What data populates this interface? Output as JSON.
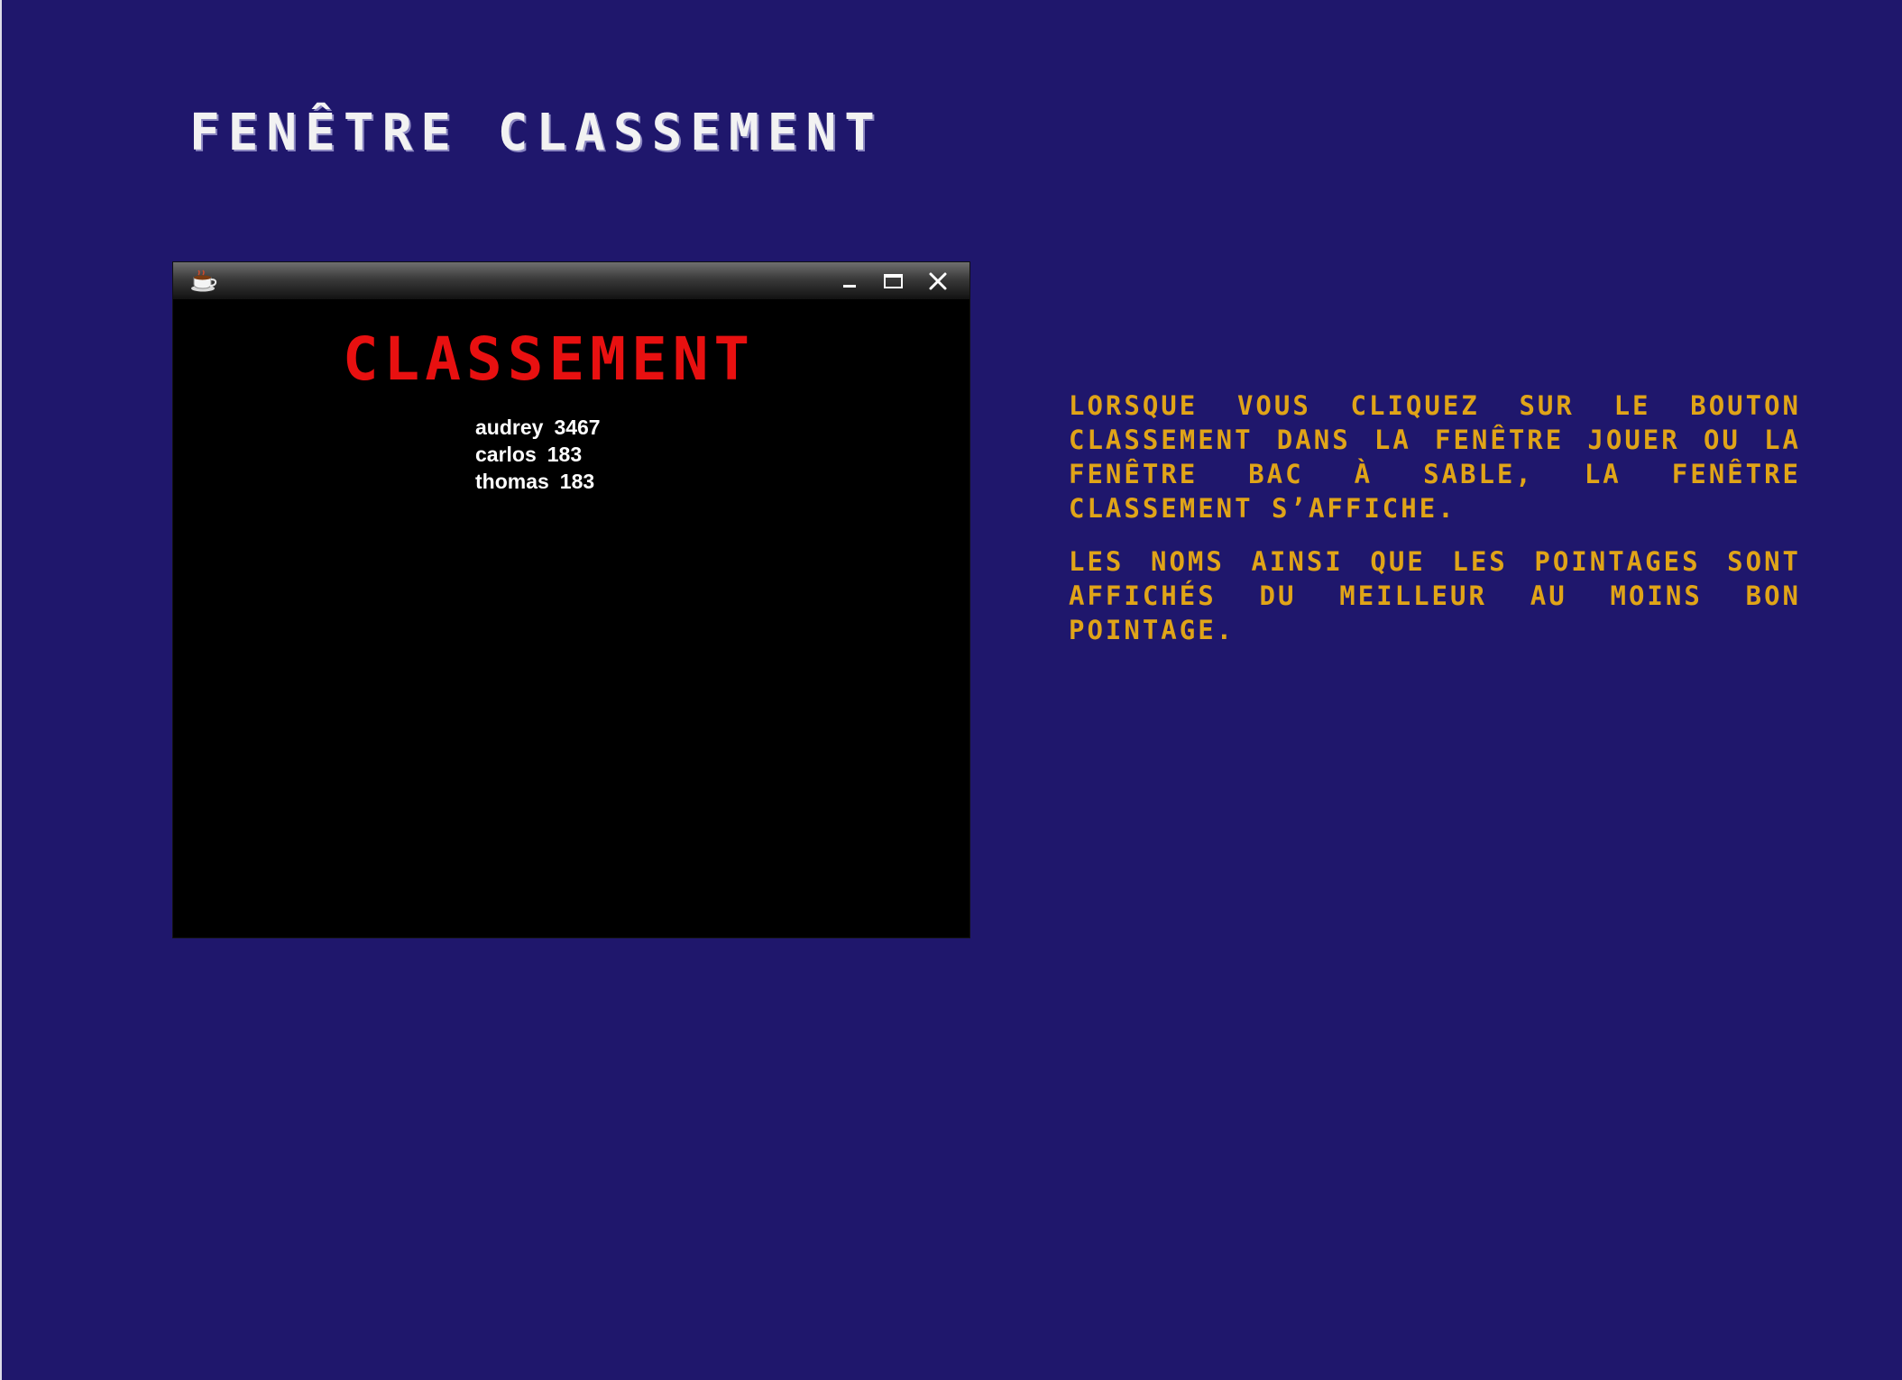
{
  "slide": {
    "title": "FENÊTRE CLASSEMENT",
    "description": [
      "LORSQUE VOUS CLIQUEZ SUR LE BOUTON CLASSEMENT DANS LA FENÊTRE JOUER OU LA FENÊTRE BAC À SABLE, LA FENÊTRE CLASSEMENT S’AFFICHE.",
      "LES NOMS AINSI QUE LES POINTAGES SONT AFFICHÉS DU MEILLEUR AU MOINS BON POINTAGE."
    ],
    "colors": {
      "background": "#1f176c",
      "title": "#f2f2f2",
      "description": "#e0a418"
    }
  },
  "window": {
    "icon": "java-coffee-cup-icon",
    "controls": [
      "minimize-icon",
      "maximize-icon",
      "close-icon"
    ],
    "heading": "CLASSEMENT",
    "heading_color": "#e81010",
    "scores": [
      {
        "name": "audrey",
        "score": "3467"
      },
      {
        "name": "carlos",
        "score": "183"
      },
      {
        "name": "thomas",
        "score": "183"
      }
    ]
  }
}
